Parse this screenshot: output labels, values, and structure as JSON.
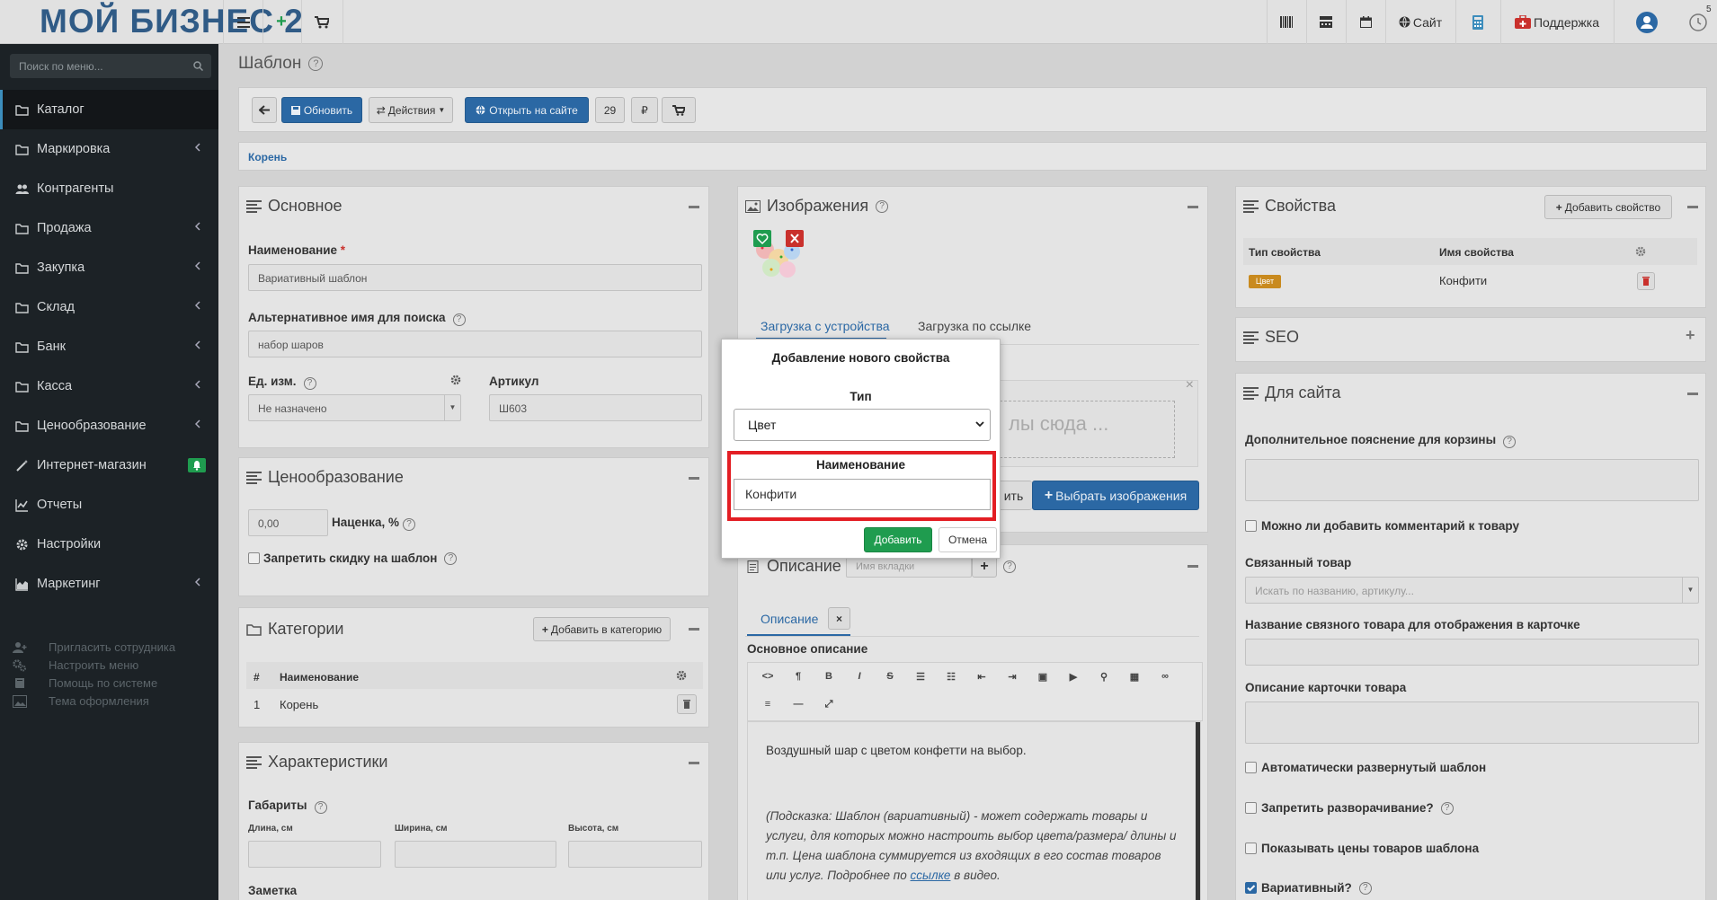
{
  "topbar": {
    "logo_text": "МОЙ БИЗНЕС 2",
    "site_label": "Сайт",
    "support_label": "Поддержка",
    "notif_count": "5"
  },
  "sidebar": {
    "search_placeholder": "Поиск по меню...",
    "items": [
      {
        "label": "Каталог",
        "icon": "folder-icon",
        "arrow": false
      },
      {
        "label": "Маркировка",
        "icon": "folder-icon",
        "arrow": true
      },
      {
        "label": "Контрагенты",
        "icon": "users-icon",
        "arrow": false
      },
      {
        "label": "Продажа",
        "icon": "folder-icon",
        "arrow": true
      },
      {
        "label": "Закупка",
        "icon": "folder-icon",
        "arrow": true
      },
      {
        "label": "Склад",
        "icon": "folder-icon",
        "arrow": true
      },
      {
        "label": "Банк",
        "icon": "folder-icon",
        "arrow": true
      },
      {
        "label": "Касса",
        "icon": "folder-icon",
        "arrow": true
      },
      {
        "label": "Ценообразование",
        "icon": "folder-icon",
        "arrow": true
      },
      {
        "label": "Интернет-магазин",
        "icon": "wand-icon",
        "arrow": false
      },
      {
        "label": "Отчеты",
        "icon": "chart-icon",
        "arrow": false
      },
      {
        "label": "Настройки",
        "icon": "gear-icon",
        "arrow": false
      },
      {
        "label": "Маркетинг",
        "icon": "area-chart-icon",
        "arrow": true
      }
    ],
    "bottom": [
      "Пригласить сотрудника",
      "Настроить меню",
      "Помощь по системе",
      "Тема оформления"
    ]
  },
  "page": {
    "title": "Шаблон",
    "toolbar": {
      "update": "Обновить",
      "actions": "Действия",
      "open_site": "Открыть на сайте",
      "count": "29",
      "currency": "₽"
    },
    "breadcrumb": "Корень"
  },
  "basic": {
    "title": "Основное",
    "name_label": "Наименование",
    "name_value": "Вариативный шаблон",
    "alt_label": "Альтернативное имя для поиска",
    "alt_value": "набор шаров",
    "unit_label": "Ед. изм.",
    "unit_value": "Не назначено",
    "sku_label": "Артикул",
    "sku_value": "Ш603"
  },
  "pricing": {
    "title": "Ценообразование",
    "markup_value": "0,00",
    "markup_label": "Наценка, %",
    "no_discount": "Запретить скидку на шаблон"
  },
  "categories": {
    "title": "Категории",
    "add_button": "Добавить в категорию",
    "col_num": "#",
    "col_name": "Наименование",
    "rows": [
      {
        "num": "1",
        "name": "Корень"
      }
    ]
  },
  "characteristics": {
    "title": "Характеристики",
    "dims_label": "Габариты",
    "length": "Длина, см",
    "width": "Ширина, см",
    "height": "Высота, см",
    "note": "Заметка"
  },
  "images": {
    "title": "Изображения",
    "tab_device": "Загрузка с устройства",
    "tab_link": "Загрузка по ссылке",
    "drop_text": "лы сюда ...",
    "partial_btn": "ить",
    "choose_btn": "Выбрать изображения"
  },
  "description": {
    "title": "Описание",
    "tab_placeholder": "Имя вкладки",
    "tab_name": "Описание",
    "main_label": "Основное описание",
    "text": "Воздушный шар с цветом конфетти на выбор.",
    "hint": "(Подсказка: Шаблон (вариативный) - может содержать товары и услуги, для которых можно настроить выбор цвета/размера/ длины и т.п. Цена шаблона суммируется из входящих в его состав товаров или услуг. Подробнее по",
    "hint_link": "ссылке",
    "hint_end": "в видео."
  },
  "properties": {
    "title": "Свойства",
    "add_button": "Добавить свойство",
    "col_type": "Тип свойства",
    "col_name": "Имя свойства",
    "rows": [
      {
        "type": "Цвет",
        "name": "Конфити"
      }
    ]
  },
  "seo": {
    "title": "SEO"
  },
  "forsite": {
    "title": "Для сайта",
    "cart_note": "Дополнительное пояснение для корзины",
    "allow_comment": "Можно ли добавить комментарий к товару",
    "linked": "Связанный товар",
    "linked_placeholder": "Искать по названию, артикулу...",
    "linked_name": "Название связного товара для отображения в карточке",
    "card_desc": "Описание карточки товара",
    "auto_expand": "Автоматически развернутый шаблон",
    "forbid_expand": "Запретить разворачивание?",
    "show_prices": "Показывать цены товаров шаблона",
    "variative": "Вариативный?"
  },
  "modal": {
    "title": "Добавление нового свойства",
    "type_label": "Тип",
    "type_value": "Цвет",
    "name_label": "Наименование",
    "name_value": "Конфити",
    "add_button": "Добавить",
    "cancel_button": "Отмена"
  },
  "colors": {
    "accent": "#2b68a4",
    "success": "#1f9c4f",
    "highlight": "#e31e24",
    "badge": "#c98a1e",
    "sidebar": "#1c2226"
  }
}
